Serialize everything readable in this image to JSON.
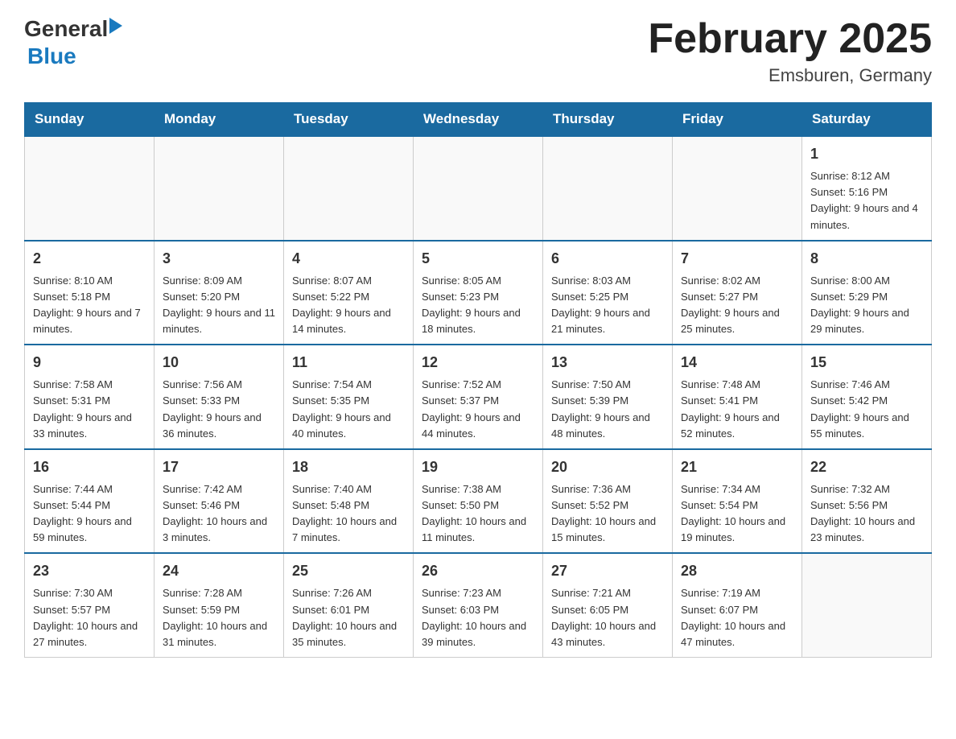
{
  "header": {
    "title": "February 2025",
    "location": "Emsburen, Germany",
    "logo_general": "General",
    "logo_blue": "Blue"
  },
  "days_of_week": [
    "Sunday",
    "Monday",
    "Tuesday",
    "Wednesday",
    "Thursday",
    "Friday",
    "Saturday"
  ],
  "weeks": [
    {
      "days": [
        {
          "date": "",
          "info": ""
        },
        {
          "date": "",
          "info": ""
        },
        {
          "date": "",
          "info": ""
        },
        {
          "date": "",
          "info": ""
        },
        {
          "date": "",
          "info": ""
        },
        {
          "date": "",
          "info": ""
        },
        {
          "date": "1",
          "info": "Sunrise: 8:12 AM\nSunset: 5:16 PM\nDaylight: 9 hours and 4 minutes."
        }
      ]
    },
    {
      "days": [
        {
          "date": "2",
          "info": "Sunrise: 8:10 AM\nSunset: 5:18 PM\nDaylight: 9 hours and 7 minutes."
        },
        {
          "date": "3",
          "info": "Sunrise: 8:09 AM\nSunset: 5:20 PM\nDaylight: 9 hours and 11 minutes."
        },
        {
          "date": "4",
          "info": "Sunrise: 8:07 AM\nSunset: 5:22 PM\nDaylight: 9 hours and 14 minutes."
        },
        {
          "date": "5",
          "info": "Sunrise: 8:05 AM\nSunset: 5:23 PM\nDaylight: 9 hours and 18 minutes."
        },
        {
          "date": "6",
          "info": "Sunrise: 8:03 AM\nSunset: 5:25 PM\nDaylight: 9 hours and 21 minutes."
        },
        {
          "date": "7",
          "info": "Sunrise: 8:02 AM\nSunset: 5:27 PM\nDaylight: 9 hours and 25 minutes."
        },
        {
          "date": "8",
          "info": "Sunrise: 8:00 AM\nSunset: 5:29 PM\nDaylight: 9 hours and 29 minutes."
        }
      ]
    },
    {
      "days": [
        {
          "date": "9",
          "info": "Sunrise: 7:58 AM\nSunset: 5:31 PM\nDaylight: 9 hours and 33 minutes."
        },
        {
          "date": "10",
          "info": "Sunrise: 7:56 AM\nSunset: 5:33 PM\nDaylight: 9 hours and 36 minutes."
        },
        {
          "date": "11",
          "info": "Sunrise: 7:54 AM\nSunset: 5:35 PM\nDaylight: 9 hours and 40 minutes."
        },
        {
          "date": "12",
          "info": "Sunrise: 7:52 AM\nSunset: 5:37 PM\nDaylight: 9 hours and 44 minutes."
        },
        {
          "date": "13",
          "info": "Sunrise: 7:50 AM\nSunset: 5:39 PM\nDaylight: 9 hours and 48 minutes."
        },
        {
          "date": "14",
          "info": "Sunrise: 7:48 AM\nSunset: 5:41 PM\nDaylight: 9 hours and 52 minutes."
        },
        {
          "date": "15",
          "info": "Sunrise: 7:46 AM\nSunset: 5:42 PM\nDaylight: 9 hours and 55 minutes."
        }
      ]
    },
    {
      "days": [
        {
          "date": "16",
          "info": "Sunrise: 7:44 AM\nSunset: 5:44 PM\nDaylight: 9 hours and 59 minutes."
        },
        {
          "date": "17",
          "info": "Sunrise: 7:42 AM\nSunset: 5:46 PM\nDaylight: 10 hours and 3 minutes."
        },
        {
          "date": "18",
          "info": "Sunrise: 7:40 AM\nSunset: 5:48 PM\nDaylight: 10 hours and 7 minutes."
        },
        {
          "date": "19",
          "info": "Sunrise: 7:38 AM\nSunset: 5:50 PM\nDaylight: 10 hours and 11 minutes."
        },
        {
          "date": "20",
          "info": "Sunrise: 7:36 AM\nSunset: 5:52 PM\nDaylight: 10 hours and 15 minutes."
        },
        {
          "date": "21",
          "info": "Sunrise: 7:34 AM\nSunset: 5:54 PM\nDaylight: 10 hours and 19 minutes."
        },
        {
          "date": "22",
          "info": "Sunrise: 7:32 AM\nSunset: 5:56 PM\nDaylight: 10 hours and 23 minutes."
        }
      ]
    },
    {
      "days": [
        {
          "date": "23",
          "info": "Sunrise: 7:30 AM\nSunset: 5:57 PM\nDaylight: 10 hours and 27 minutes."
        },
        {
          "date": "24",
          "info": "Sunrise: 7:28 AM\nSunset: 5:59 PM\nDaylight: 10 hours and 31 minutes."
        },
        {
          "date": "25",
          "info": "Sunrise: 7:26 AM\nSunset: 6:01 PM\nDaylight: 10 hours and 35 minutes."
        },
        {
          "date": "26",
          "info": "Sunrise: 7:23 AM\nSunset: 6:03 PM\nDaylight: 10 hours and 39 minutes."
        },
        {
          "date": "27",
          "info": "Sunrise: 7:21 AM\nSunset: 6:05 PM\nDaylight: 10 hours and 43 minutes."
        },
        {
          "date": "28",
          "info": "Sunrise: 7:19 AM\nSunset: 6:07 PM\nDaylight: 10 hours and 47 minutes."
        },
        {
          "date": "",
          "info": ""
        }
      ]
    }
  ]
}
